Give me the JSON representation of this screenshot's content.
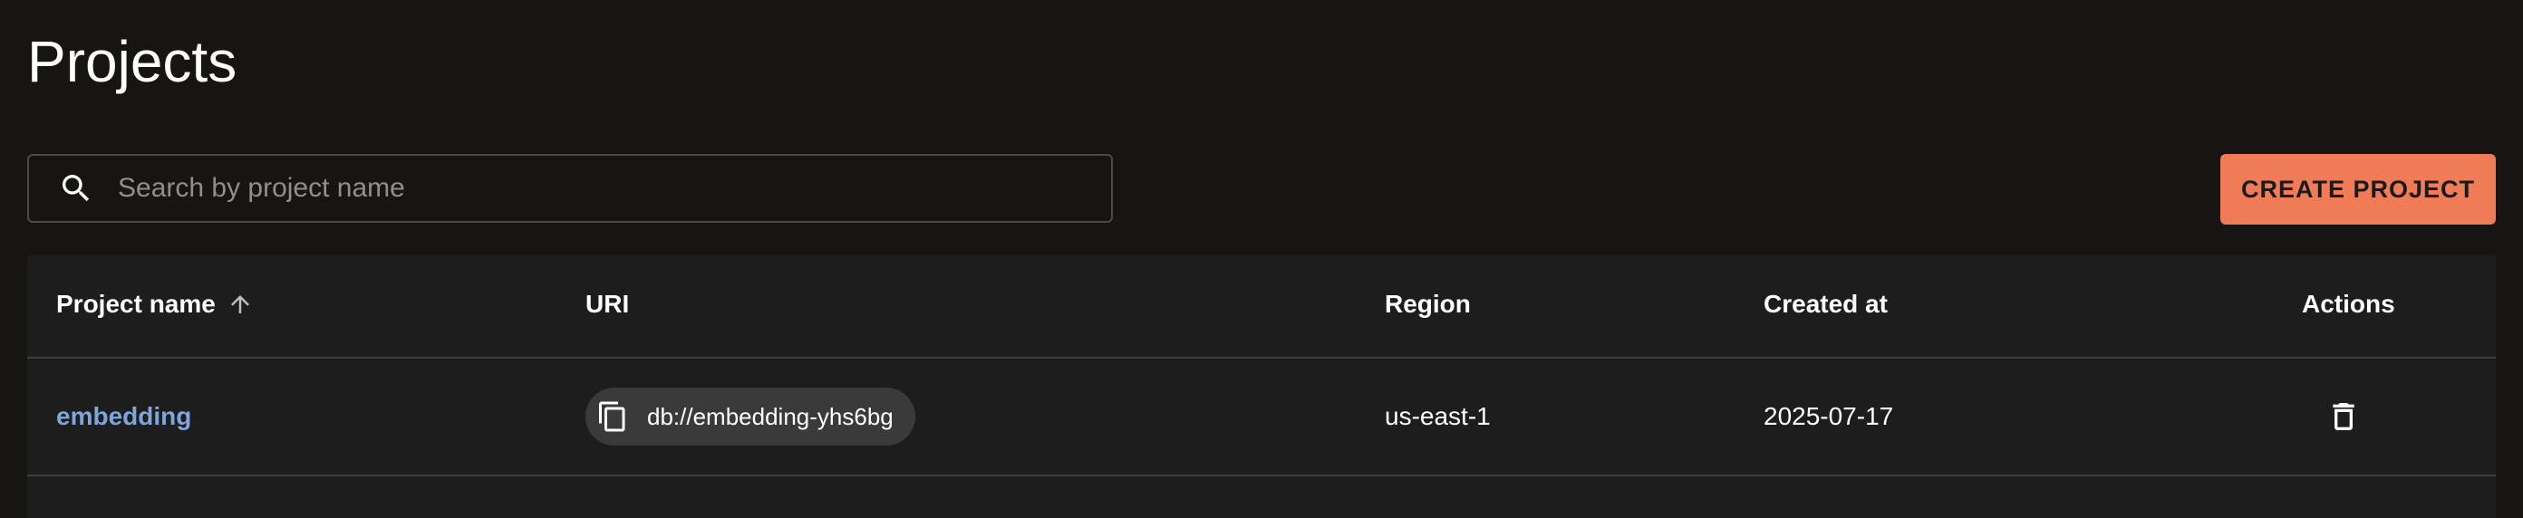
{
  "page": {
    "title": "Projects"
  },
  "search": {
    "placeholder": "Search by project name",
    "value": "",
    "icon": "search-icon"
  },
  "actions": {
    "create_label": "CREATE PROJECT"
  },
  "table": {
    "columns": {
      "name": "Project name",
      "uri": "URI",
      "region": "Region",
      "created": "Created at",
      "actions": "Actions"
    },
    "sort": {
      "column": "Project name",
      "direction": "ascending"
    },
    "rows": [
      {
        "name": "embedding",
        "uri": "db://embedding-yhs6bg",
        "region": "us-east-1",
        "created_at": "2025-07-17"
      }
    ]
  },
  "colors": {
    "background": "#161514",
    "accent": "#f07b57",
    "link": "#7fa6d9",
    "table_bg": "#1d1d1d",
    "chip_bg": "#3a3a3a"
  }
}
